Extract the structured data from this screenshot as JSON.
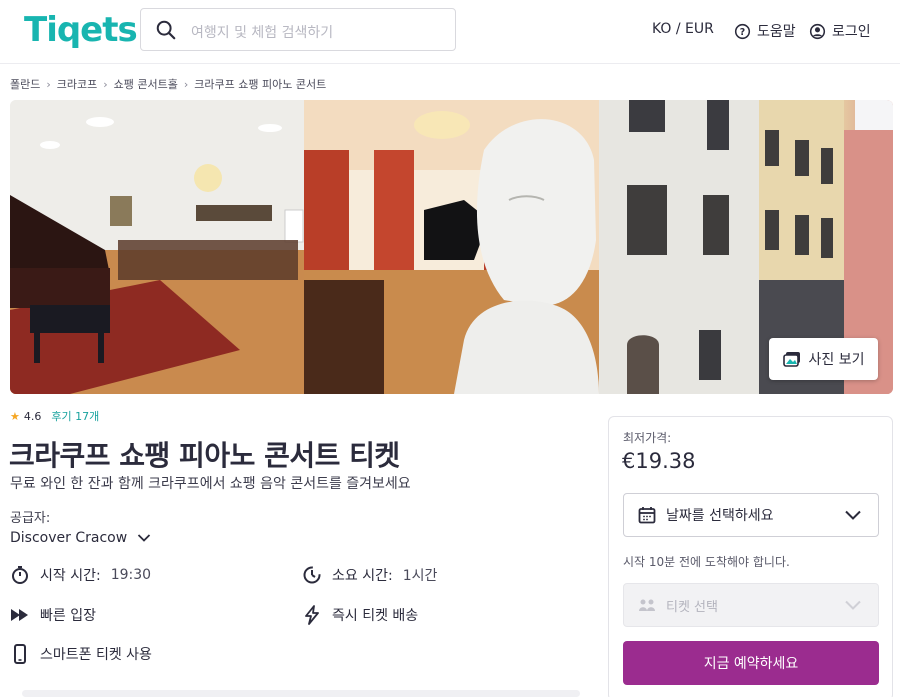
{
  "header": {
    "logo": "Tiqets",
    "search_placeholder": "여행지 및 체험 검색하기",
    "locale": "KO / EUR",
    "help": "도움말",
    "login": "로그인"
  },
  "breadcrumb": [
    "폴란드",
    "크라코프",
    "쇼팽 콘서트홀",
    "크라쿠프 쇼팽 피아노 콘서트"
  ],
  "gallery": {
    "photos": [
      "piano-hall-photo",
      "chopin-bust-photo",
      "street-building-photo"
    ],
    "show_photos_label": "사진 보기"
  },
  "product": {
    "rating": "4.6",
    "reviews": "후기 17개",
    "title": "크라쿠프 쇼팽 피아노 콘서트 티켓",
    "subtitle": "무료 와인 한 잔과 함께 크라쿠프에서 쇼팽 음악 콘서트를 즐겨보세요",
    "supplier_label": "공급자:",
    "supplier_name": "Discover Cracow",
    "features": {
      "start_label": "시작 시간:",
      "start_value": "19:30",
      "duration_label": "소요 시간:",
      "duration_value": "1시간",
      "fast_entry": "빠른 입장",
      "instant_delivery": "즉시 티켓 배송",
      "smartphone": "스마트폰 티켓 사용"
    }
  },
  "booking": {
    "price_label": "최저가격:",
    "price": "€19.38",
    "date_placeholder": "날짜를 선택하세요",
    "arrive_note": "시작 10분 전에 도착해야 합니다.",
    "ticket_placeholder": "티켓 선택",
    "book_button": "지금 예약하세요"
  },
  "colors": {
    "brand": "#18b5b0",
    "book_button": "#9b2c8f",
    "star": "#f5a623"
  }
}
